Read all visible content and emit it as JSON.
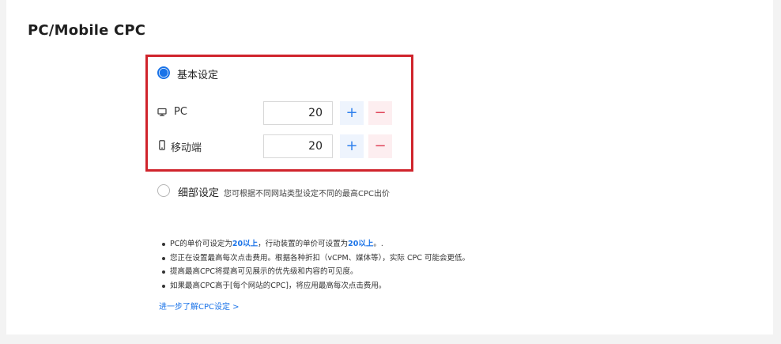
{
  "section": {
    "title": "PC/Mobile CPC"
  },
  "basic": {
    "label": "基本设定",
    "selected": true,
    "pc": {
      "label": "PC",
      "value": "20",
      "plus": "+",
      "minus": "−"
    },
    "mobile": {
      "label": "移动端",
      "value": "20",
      "plus": "+",
      "minus": "−"
    }
  },
  "detail": {
    "label": "细部设定",
    "description": "您可根据不同网站类型设定不同的最高CPC出价",
    "selected": false
  },
  "notes": {
    "n1": {
      "pre": "PC的单价可设定为",
      "hl1": "20以上",
      "mid": "，行动装置的单价可设置为",
      "hl2": "20以上",
      "post": "。."
    },
    "n2": "您正在设置最高每次点击费用。根据各种折扣（vCPM、媒体等），实际 CPC 可能会更低。",
    "n3": "提高最高CPC将提高可见展示的优先级和内容的可见度。",
    "n4": "如果最高CPC高于[每个网站的CPC]，将应用最高每次点击费用。"
  },
  "link": {
    "label": "进一步了解CPC设定 >"
  },
  "colors": {
    "accent": "#1a73e8",
    "highlight_border": "#d0242c",
    "minus": "#e0465a"
  },
  "icons": {
    "pc": "monitor-icon",
    "mobile": "phone-icon"
  }
}
